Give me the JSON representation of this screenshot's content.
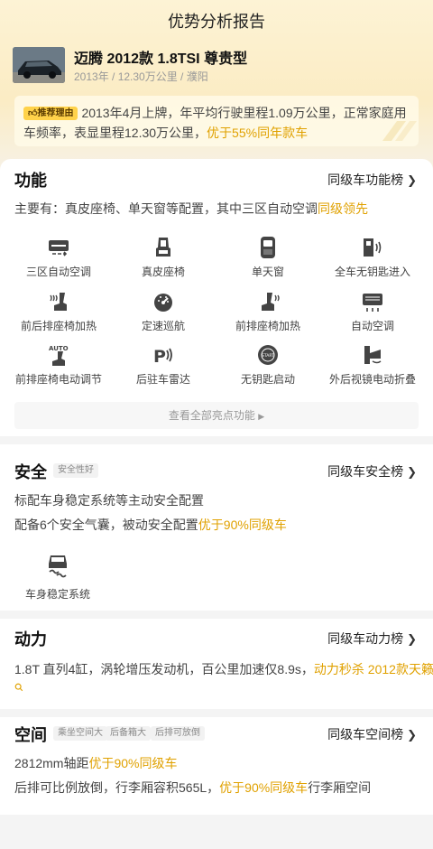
{
  "header": {
    "title": "优势分析报告"
  },
  "car": {
    "name": "迈腾 2012款 1.8TSI 尊贵型",
    "meta": "2013年 / 12.30万公里 / 濮阳"
  },
  "reason": {
    "badge": "推荐理由",
    "text": "2013年4月上牌，年平均行驶里程1.09万公里，正常家庭用车频率，表显里程12.30万公里，",
    "highlight": "优于55%同年款车"
  },
  "features": {
    "title": "功能",
    "link": "同级车功能榜",
    "summary_prefix": "主要有：真皮座椅、单天窗等配置，其中三区自动空调",
    "summary_highlight": "同级领先",
    "items": [
      {
        "label": "三区自动空调",
        "icon": "climate-zone-icon"
      },
      {
        "label": "真皮座椅",
        "icon": "leather-seat-icon"
      },
      {
        "label": "单天窗",
        "icon": "sunroof-icon"
      },
      {
        "label": "全车无钥匙进入",
        "icon": "keyless-entry-icon"
      },
      {
        "label": "前后排座椅加热",
        "icon": "seat-heating-icon"
      },
      {
        "label": "定速巡航",
        "icon": "cruise-control-icon"
      },
      {
        "label": "前排座椅加热",
        "icon": "front-seat-heating-icon"
      },
      {
        "label": "自动空调",
        "icon": "auto-ac-icon"
      },
      {
        "label": "前排座椅电动调节",
        "icon": "power-seat-icon"
      },
      {
        "label": "后驻车雷达",
        "icon": "parking-radar-icon"
      },
      {
        "label": "无钥匙启动",
        "icon": "start-button-icon"
      },
      {
        "label": "外后视镜电动折叠",
        "icon": "mirror-fold-icon"
      }
    ],
    "view_all": "查看全部亮点功能"
  },
  "safety": {
    "title": "安全",
    "tag": "安全性好",
    "link": "同级车安全榜",
    "line1": "标配车身稳定系统等主动安全配置",
    "line2_prefix": "配备6个安全气囊，被动安全配置",
    "line2_highlight": "优于90%同级车",
    "esp_label": "车身稳定系统"
  },
  "power": {
    "title": "动力",
    "link": "同级车动力榜",
    "text": "1.8T 直列4缸，涡轮增压发动机，百公里加速仅8.9s，",
    "highlight": "动力秒杀 2012款天籁"
  },
  "space": {
    "title": "空间",
    "tags": [
      "乘坐空间大",
      "后备箱大",
      "后排可放倒"
    ],
    "link": "同级车空间榜",
    "line1_prefix": "2812mm轴距",
    "line1_highlight": "优于90%同级车",
    "line2_prefix": "后排可比例放倒，行李厢容积565L，",
    "line2_highlight": "优于90%同级车",
    "line2_suffix": "行李厢空间"
  },
  "colors": {
    "accent": "#e0a100",
    "hero_top": "#fdf3d5",
    "badge": "#ffd24a",
    "icon": "#444444"
  }
}
